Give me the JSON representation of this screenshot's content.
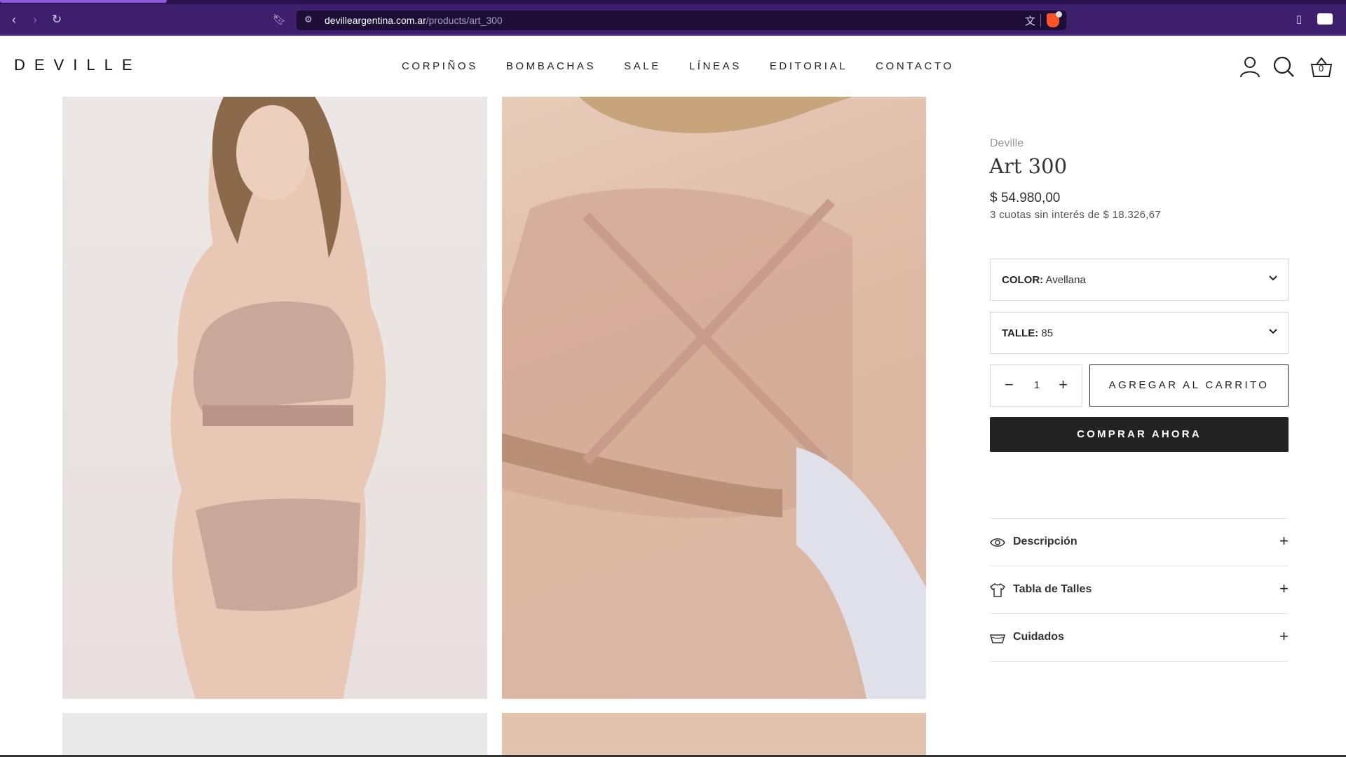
{
  "browser": {
    "url_domain": "devilleargentina.com.ar",
    "url_path": "/products/art_300",
    "icons": [
      "back-icon",
      "forward-icon",
      "reload-icon",
      "bookmark-icon",
      "site-settings-icon",
      "translate-icon",
      "brave-shields-icon",
      "sidebar-icon",
      "wallet-icon"
    ]
  },
  "header": {
    "logo": "DEVILLE",
    "nav": [
      "CORPIÑOS",
      "BOMBACHAS",
      "SALE",
      "LÍNEAS",
      "EDITORIAL",
      "CONTACTO"
    ],
    "cart_count": "0"
  },
  "product": {
    "brand": "Deville",
    "title": "Art 300",
    "price": "$ 54.980,00",
    "installments": "3 cuotas sin interés de $ 18.326,67",
    "color_label": "COLOR:",
    "color_value": "Avellana",
    "size_label": "TALLE:",
    "size_value": "85",
    "quantity": "1",
    "add_to_cart": "AGREGAR AL CARRITO",
    "buy_now": "COMPRAR AHORA"
  },
  "accordion": [
    {
      "title": "Descripción",
      "icon": "eye-icon"
    },
    {
      "title": "Tabla de Talles",
      "icon": "shirt-icon"
    },
    {
      "title": "Cuidados",
      "icon": "basin-icon"
    }
  ],
  "colors": {
    "browser_bg": "#3d1f6e",
    "address_bg": "#1c0e36",
    "button_dark": "#222222"
  }
}
